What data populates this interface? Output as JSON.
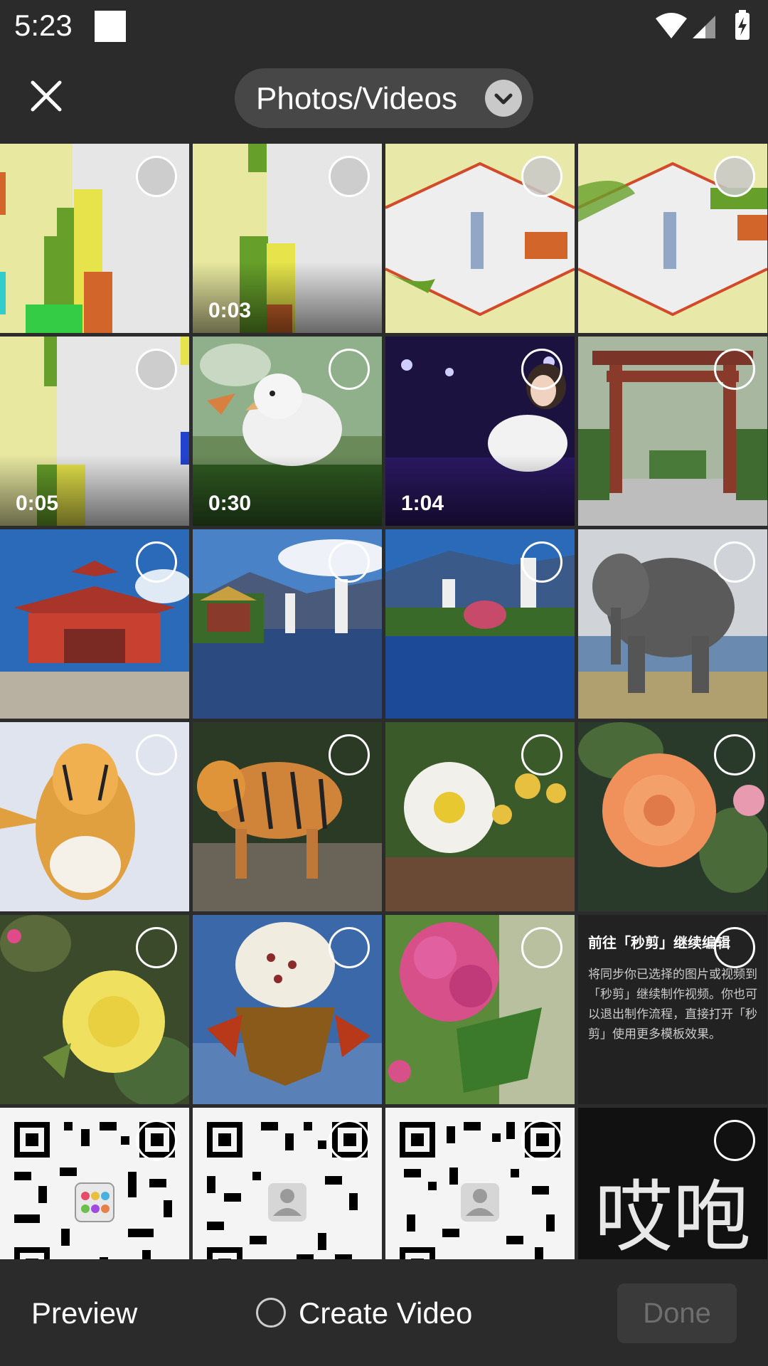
{
  "status_bar": {
    "time": "5:23"
  },
  "header": {
    "album_selector": "Photos/Videos"
  },
  "grid": {
    "items": [
      {
        "type": "image"
      },
      {
        "type": "video",
        "duration": "0:03"
      },
      {
        "type": "image"
      },
      {
        "type": "image"
      },
      {
        "type": "video",
        "duration": "0:05"
      },
      {
        "type": "video",
        "duration": "0:30"
      },
      {
        "type": "video",
        "duration": "1:04"
      },
      {
        "type": "image"
      },
      {
        "type": "image"
      },
      {
        "type": "image"
      },
      {
        "type": "image"
      },
      {
        "type": "image"
      },
      {
        "type": "image"
      },
      {
        "type": "image"
      },
      {
        "type": "image"
      },
      {
        "type": "image"
      },
      {
        "type": "image"
      },
      {
        "type": "image"
      },
      {
        "type": "image"
      },
      {
        "type": "image"
      },
      {
        "type": "image"
      },
      {
        "type": "image"
      },
      {
        "type": "image"
      },
      {
        "type": "image"
      }
    ],
    "text_card": {
      "title": "前往「秒剪」继续编辑",
      "body": "将同步你已选择的图片或视频到「秒剪」继续制作视频。你也可以退出制作流程，直接打开「秒剪」使用更多模板效果。"
    },
    "brand_image_text": "哎咆"
  },
  "bottom_bar": {
    "preview_label": "Preview",
    "create_video_label": "Create Video",
    "done_label": "Done"
  },
  "colors": {
    "background": "#2c2c2c",
    "bar": "#2b2b2b",
    "pill": "#474747",
    "done_disabled_text": "#6e6e6e"
  }
}
